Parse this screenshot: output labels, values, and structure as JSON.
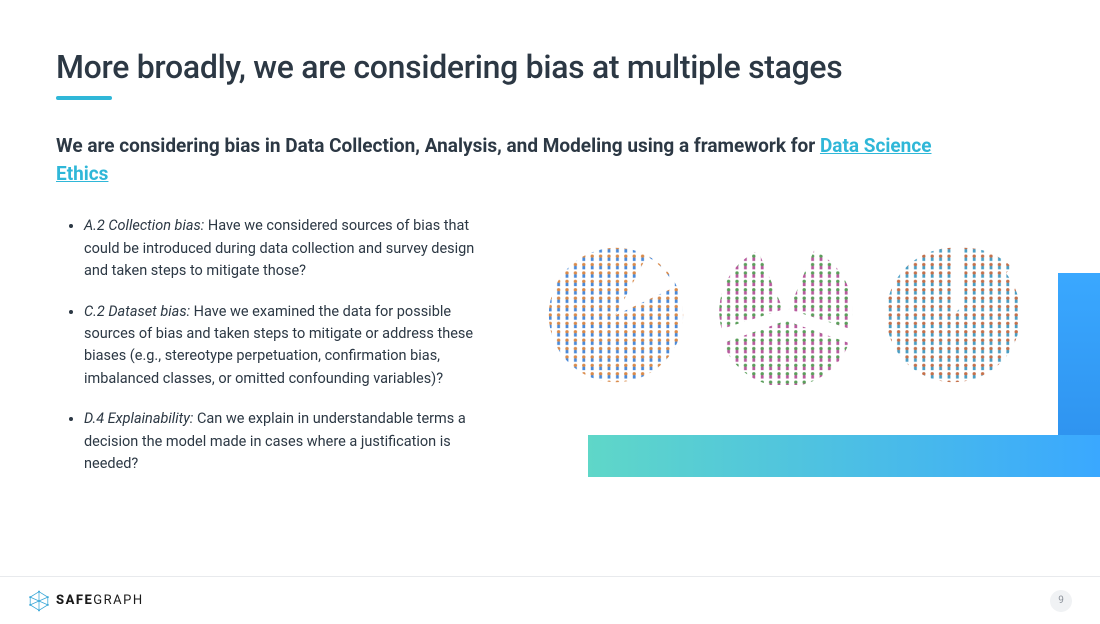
{
  "title": "More broadly, we are considering bias at multiple stages",
  "subtitle_pre": "We are considering bias in Data Collection, Analysis, and Modeling using a framework for ",
  "subtitle_link": "Data Science Ethics",
  "bullets": [
    {
      "lead": "A.2 Collection bias:",
      "body": " Have we considered sources of bias that could be introduced during data collection and survey design and taken steps to mitigate those?"
    },
    {
      "lead": "C.2 Dataset bias:",
      "body": " Have we examined the data for possible sources of bias and taken steps to mitigate or address these biases (e.g., stereotype perpetuation, confirmation bias, imbalanced classes, or omitted confounding variables)?"
    },
    {
      "lead": "D.4 Explainability:",
      "body": " Can we explain in understandable terms a decision the model made in cases where a justification is needed?"
    }
  ],
  "logo": {
    "bold": "SAFE",
    "rest": "GRAPH"
  },
  "page_number": "9"
}
